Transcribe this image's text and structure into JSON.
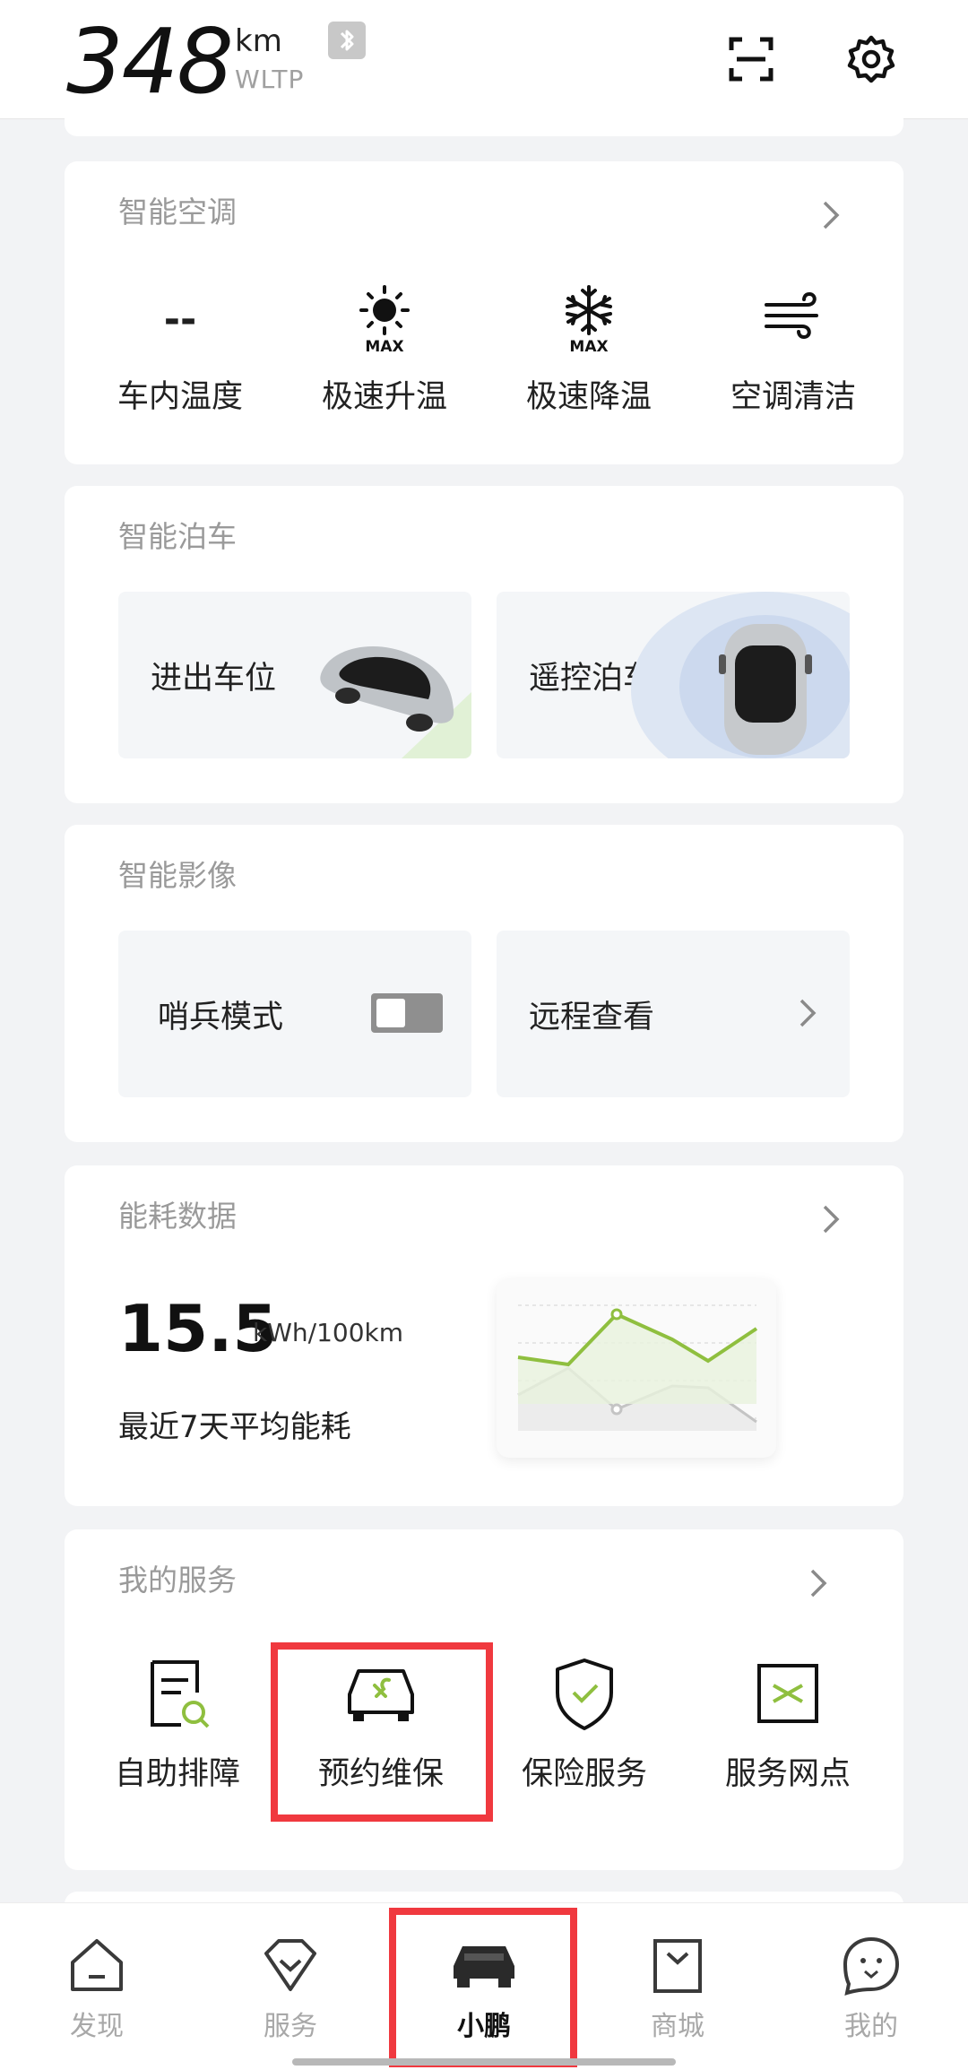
{
  "header": {
    "range_value": "348",
    "range_unit": "km",
    "range_standard": "WLTP",
    "icons": [
      "bluetooth-icon",
      "scan-icon",
      "gear-icon"
    ]
  },
  "climate": {
    "title": "智能空调",
    "items": [
      {
        "value": "--",
        "label": "车内温度"
      },
      {
        "icon": "sun-max-icon",
        "icon_text": "MAX",
        "label": "极速升温"
      },
      {
        "icon": "snowflake-max-icon",
        "icon_text": "MAX",
        "label": "极速降温"
      },
      {
        "icon": "wind-icon",
        "label": "空调清洁"
      }
    ]
  },
  "parking": {
    "title": "智能泊车",
    "tiles": [
      {
        "label": "进出车位"
      },
      {
        "label": "遥控泊车"
      }
    ]
  },
  "imaging": {
    "title": "智能影像",
    "sentry_label": "哨兵模式",
    "sentry_on": false,
    "remote_label": "远程查看"
  },
  "energy": {
    "title": "能耗数据",
    "value": "15.5",
    "unit": "kWh/100km",
    "description": "最近7天平均能耗"
  },
  "services": {
    "title": "我的服务",
    "items": [
      {
        "label": "自助排障",
        "icon": "diagnose-icon"
      },
      {
        "label": "预约维保",
        "icon": "maintenance-icon",
        "highlighted": true
      },
      {
        "label": "保险服务",
        "icon": "insurance-shield-icon"
      },
      {
        "label": "服务网点",
        "icon": "service-point-icon"
      }
    ]
  },
  "tabbar": {
    "tabs": [
      {
        "label": "发现",
        "icon": "home-icon"
      },
      {
        "label": "服务",
        "icon": "service-gem-icon"
      },
      {
        "label": "小鹏",
        "icon": "car-icon",
        "active": true
      },
      {
        "label": "商城",
        "icon": "shop-bag-icon"
      },
      {
        "label": "我的",
        "icon": "profile-face-icon"
      }
    ]
  },
  "colors": {
    "accent_green": "#8fbf3f",
    "highlight_red": "#f0393f",
    "background": "#f2f3f5"
  }
}
